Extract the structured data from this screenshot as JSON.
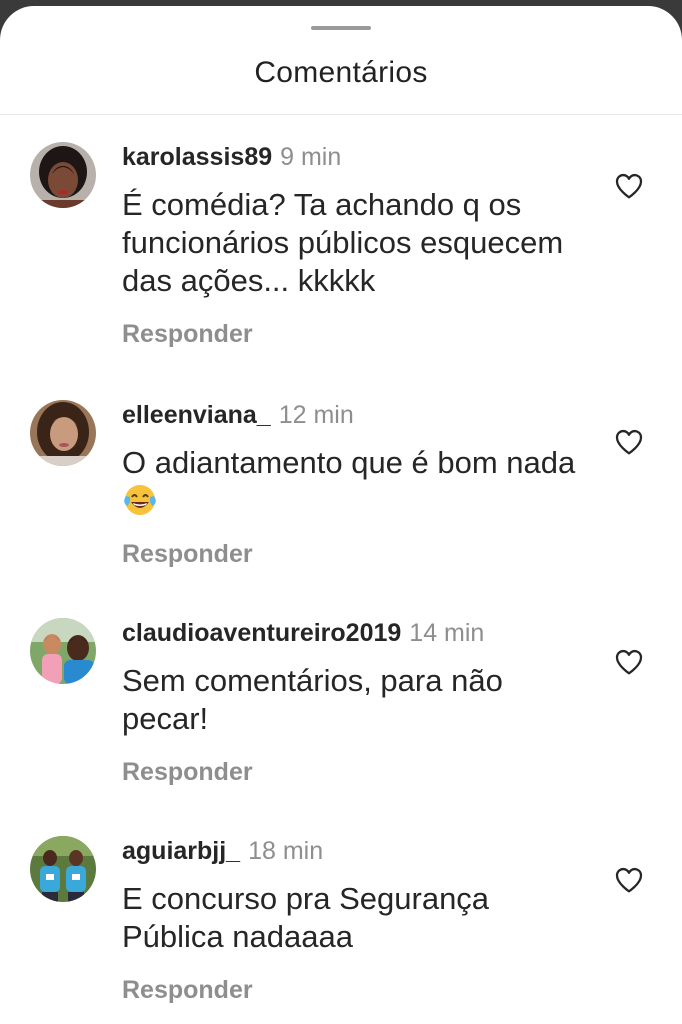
{
  "header": {
    "title": "Comentários"
  },
  "comments": [
    {
      "username": "karolassis89",
      "time": "9 min",
      "text": "É comédia? Ta achando q os funcionários públicos esquecem das ações... kkkkk",
      "reply_label": "Responder",
      "avatar": "user-avatar-photo"
    },
    {
      "username": "elleenviana_",
      "time": "12 min",
      "text": "O adiantamento que é bom nada",
      "emoji": "face-with-tears-of-joy",
      "reply_label": "Responder",
      "avatar": "user-avatar-photo"
    },
    {
      "username": "claudioaventureiro2019",
      "time": "14 min",
      "text": "Sem comentários, para não pecar!",
      "reply_label": "Responder",
      "avatar": "user-avatar-photo"
    },
    {
      "username": "aguiarbjj_",
      "time": "18 min",
      "text": "E concurso pra Segurança Pública nadaaaa",
      "reply_label": "Responder",
      "avatar": "user-avatar-photo"
    }
  ],
  "icons": {
    "like": "heart-outline-icon"
  },
  "colors": {
    "text": "#262626",
    "secondary": "#8e8e8e",
    "background": "#ffffff"
  }
}
